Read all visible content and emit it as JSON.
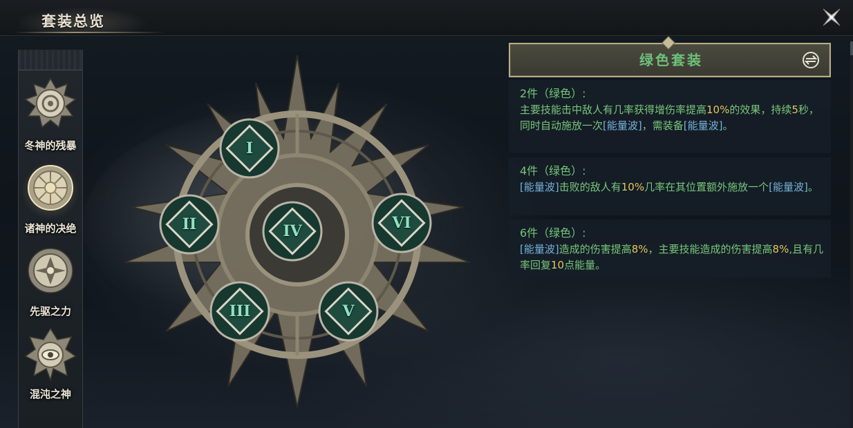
{
  "header": {
    "title": "套装总览"
  },
  "sidebar": {
    "items": [
      {
        "label": "冬神的残暴",
        "icon": "winter-god-emblem-icon"
      },
      {
        "label": "诸神的决绝",
        "icon": "gods-resolve-emblem-icon",
        "active": true
      },
      {
        "label": "先驱之力",
        "icon": "pioneer-power-emblem-icon"
      },
      {
        "label": "混沌之神",
        "icon": "chaos-god-emblem-icon"
      }
    ]
  },
  "emblem": {
    "nodes": [
      "I",
      "II",
      "IV",
      "VI",
      "III",
      "V"
    ]
  },
  "set_panel": {
    "title": "绿色套装",
    "bonuses": [
      {
        "title": "2件（绿色）:",
        "segments": [
          {
            "t": "主要技能击中敌人有几率获得增伤率提高",
            "c": "n"
          },
          {
            "t": "10%",
            "c": "hl"
          },
          {
            "t": "的效果，持续",
            "c": "n"
          },
          {
            "t": "5",
            "c": "hl"
          },
          {
            "t": "秒，同时自动施放一次",
            "c": "n"
          },
          {
            "t": "[能量波]",
            "c": "kw"
          },
          {
            "t": "，需装备",
            "c": "n"
          },
          {
            "t": "[能量波]",
            "c": "kw"
          },
          {
            "t": "。",
            "c": "n"
          }
        ]
      },
      {
        "title": "4件（绿色）:",
        "segments": [
          {
            "t": "[能量波]",
            "c": "kw"
          },
          {
            "t": "击败的敌人有",
            "c": "n"
          },
          {
            "t": "10%",
            "c": "hl"
          },
          {
            "t": "几率在其位置额外施放一个",
            "c": "n"
          },
          {
            "t": "[能量波]",
            "c": "kw"
          },
          {
            "t": "。",
            "c": "n"
          }
        ]
      },
      {
        "title": "6件（绿色）:",
        "segments": [
          {
            "t": "[能量波]",
            "c": "kw"
          },
          {
            "t": "造成的伤害提高",
            "c": "n"
          },
          {
            "t": "8%",
            "c": "hl"
          },
          {
            "t": "，主要技能造成的伤害提高",
            "c": "n"
          },
          {
            "t": "8%",
            "c": "hl"
          },
          {
            "t": ",且有几率回复",
            "c": "n"
          },
          {
            "t": "10",
            "c": "hl"
          },
          {
            "t": "点能量。",
            "c": "n"
          }
        ]
      }
    ]
  },
  "colors": {
    "set_green": "#6ec07a",
    "highlight_gold": "#e2c85b",
    "keyword_blue": "#74b3d8",
    "node_teal": "#8fe0c2"
  }
}
